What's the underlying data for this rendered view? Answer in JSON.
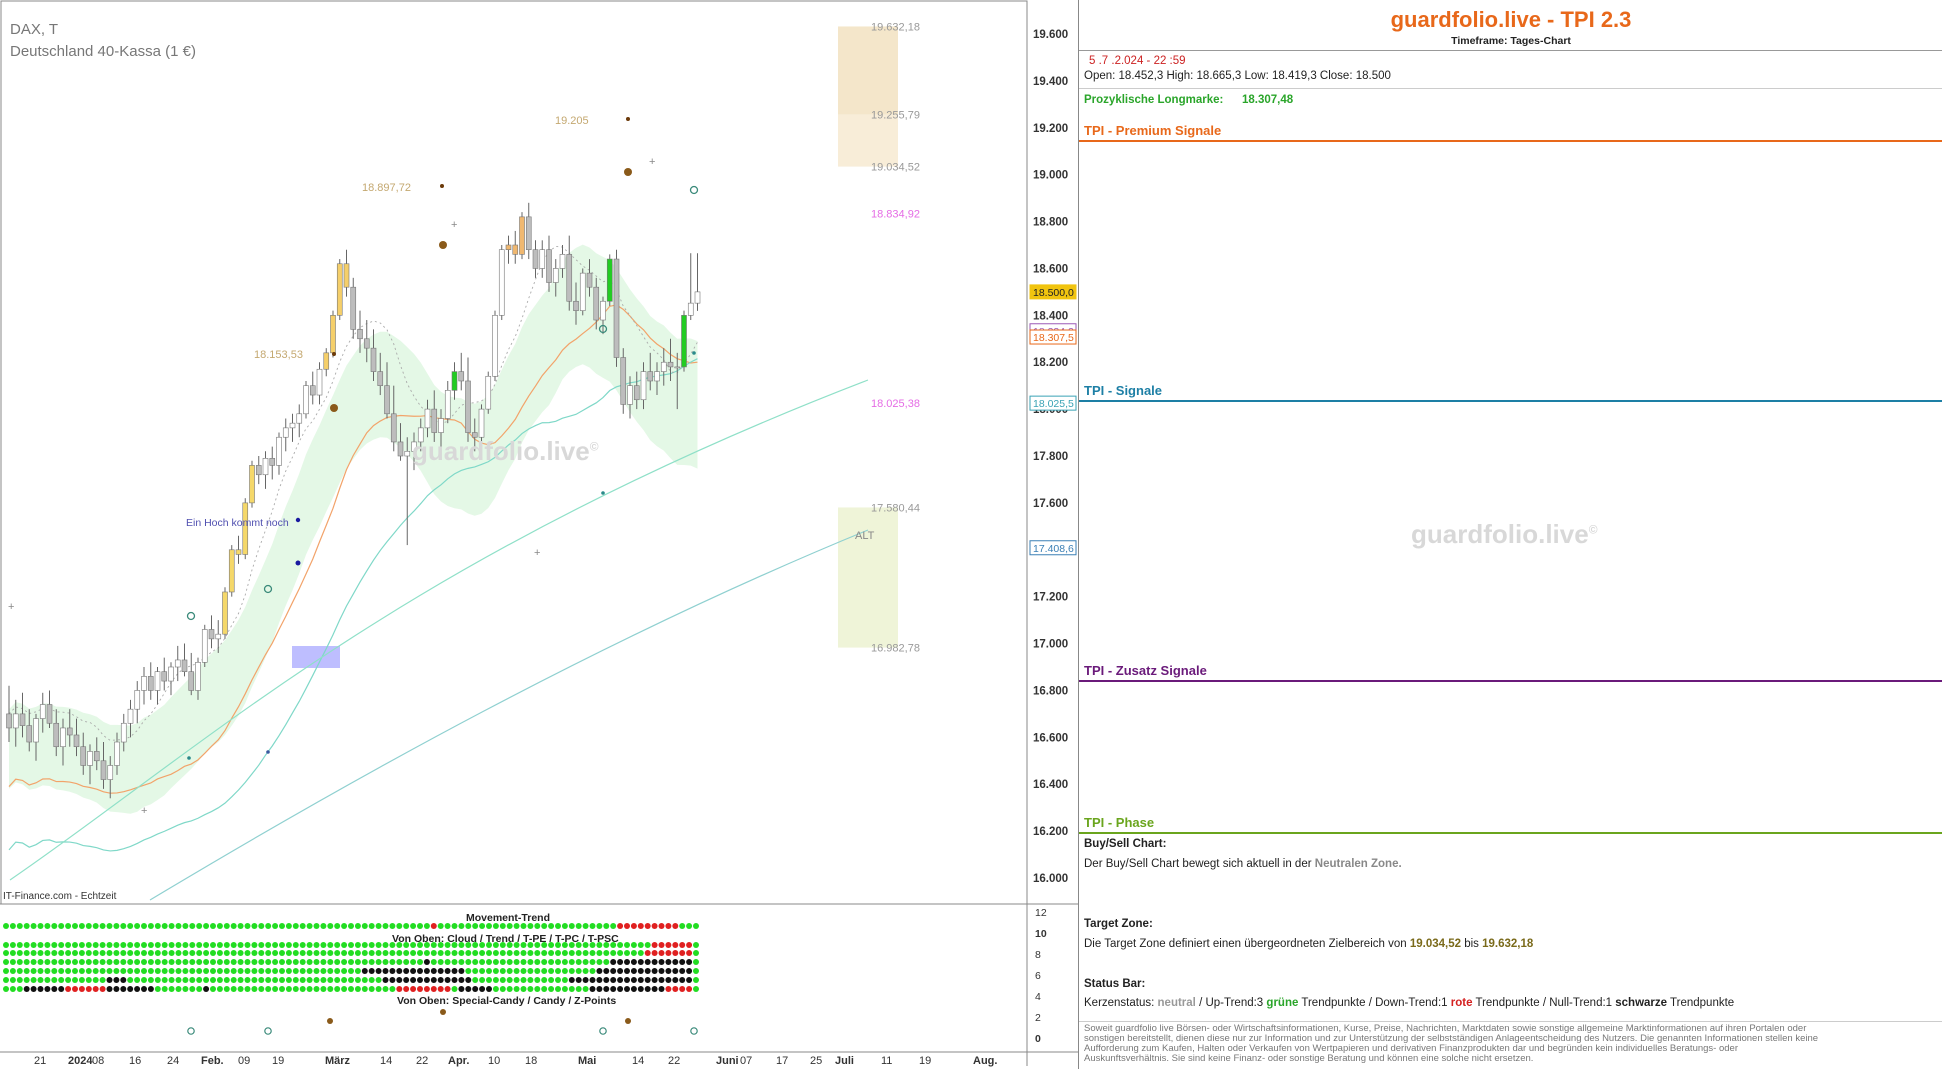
{
  "chart_data": {
    "type": "candlestick",
    "symbol": "DAX, T",
    "subtitle": "Deutschland 40-Kassa (1 €)",
    "source_label": "IT-Finance.com - Echtzeit",
    "watermark": "guardfolio.live",
    "y_axis": {
      "ylim": [
        15850,
        19720
      ],
      "ticks": [
        "19.600",
        "19.400",
        "19.200",
        "19.000",
        "18.800",
        "18.600",
        "18.400",
        "18.200",
        "18.000",
        "17.800",
        "17.600",
        "17.400",
        "17.200",
        "17.000",
        "16.800",
        "16.600",
        "16.400",
        "16.200",
        "16.000"
      ]
    },
    "x_axis": {
      "ticks": [
        "21",
        "2024",
        "08",
        "16",
        "24",
        "Feb.",
        "09",
        "19",
        "März",
        "14",
        "22",
        "Apr.",
        "10",
        "18",
        "Mai",
        "14",
        "22",
        "Juni",
        "07",
        "17",
        "25",
        "Juli",
        "11",
        "19",
        "Aug."
      ]
    },
    "price_tags": [
      {
        "label": "18.500,0",
        "color": "#f1c40f"
      },
      {
        "label": "18.334,2",
        "color": "#9b59b6"
      },
      {
        "label": "18.307,5",
        "color": "#e8681a"
      },
      {
        "label": "18.025,5",
        "color": "#3aa3b5"
      },
      {
        "label": "17.408,6",
        "color": "#3a7fb5"
      }
    ],
    "level_labels": [
      "19.632,18",
      "19.255,79",
      "19.034,52",
      "18.834,92",
      "18.025,38",
      "17.580,44",
      "16.982,78"
    ],
    "annotations": [
      "19.205",
      "18.897,72",
      "18.153,53",
      "Ein Hoch kommt noch",
      "ALT"
    ],
    "ohlc": [
      [
        16700,
        16820,
        16580,
        16640
      ],
      [
        16640,
        16760,
        16560,
        16700
      ],
      [
        16700,
        16790,
        16600,
        16650
      ],
      [
        16650,
        16720,
        16540,
        16580
      ],
      [
        16580,
        16700,
        16500,
        16680
      ],
      [
        16680,
        16790,
        16620,
        16740
      ],
      [
        16740,
        16800,
        16640,
        16660
      ],
      [
        16660,
        16720,
        16520,
        16560
      ],
      [
        16560,
        16680,
        16480,
        16640
      ],
      [
        16640,
        16720,
        16560,
        16610
      ],
      [
        16610,
        16680,
        16520,
        16560
      ],
      [
        16560,
        16620,
        16440,
        16480
      ],
      [
        16480,
        16570,
        16400,
        16540
      ],
      [
        16540,
        16600,
        16460,
        16500
      ],
      [
        16500,
        16580,
        16380,
        16420
      ],
      [
        16420,
        16520,
        16340,
        16480
      ],
      [
        16480,
        16620,
        16440,
        16580
      ],
      [
        16580,
        16700,
        16540,
        16660
      ],
      [
        16660,
        16760,
        16600,
        16720
      ],
      [
        16720,
        16840,
        16660,
        16800
      ],
      [
        16800,
        16900,
        16740,
        16860
      ],
      [
        16860,
        16920,
        16760,
        16800
      ],
      [
        16800,
        16900,
        16740,
        16880
      ],
      [
        16880,
        16940,
        16800,
        16840
      ],
      [
        16840,
        16920,
        16780,
        16900
      ],
      [
        16900,
        16990,
        16840,
        16930
      ],
      [
        16930,
        17000,
        16860,
        16880
      ],
      [
        16880,
        16960,
        16780,
        16800
      ],
      [
        16800,
        16940,
        16760,
        16920
      ],
      [
        16920,
        17080,
        16900,
        17060
      ],
      [
        17060,
        17120,
        16980,
        17020
      ],
      [
        17020,
        17100,
        16960,
        17040
      ],
      [
        17040,
        17240,
        17020,
        17220
      ],
      [
        17220,
        17420,
        17200,
        17400
      ],
      [
        17400,
        17460,
        17340,
        17380
      ],
      [
        17380,
        17620,
        17360,
        17600
      ],
      [
        17600,
        17780,
        17580,
        17760
      ],
      [
        17760,
        17800,
        17680,
        17720
      ],
      [
        17720,
        17820,
        17660,
        17790
      ],
      [
        17790,
        17840,
        17700,
        17760
      ],
      [
        17760,
        17900,
        17720,
        17880
      ],
      [
        17880,
        17960,
        17820,
        17920
      ],
      [
        17920,
        17980,
        17860,
        17940
      ],
      [
        17940,
        18020,
        17880,
        17980
      ],
      [
        17980,
        18120,
        17960,
        18100
      ],
      [
        18100,
        18160,
        18020,
        18060
      ],
      [
        18060,
        18200,
        18020,
        18170
      ],
      [
        18170,
        18260,
        18140,
        18240
      ],
      [
        18240,
        18420,
        18220,
        18400
      ],
      [
        18400,
        18640,
        18380,
        18620
      ],
      [
        18620,
        18680,
        18480,
        18520
      ],
      [
        18520,
        18560,
        18300,
        18340
      ],
      [
        18340,
        18420,
        18240,
        18300
      ],
      [
        18300,
        18380,
        18200,
        18260
      ],
      [
        18260,
        18340,
        18120,
        18160
      ],
      [
        18160,
        18240,
        18060,
        18100
      ],
      [
        18100,
        18200,
        17960,
        17980
      ],
      [
        17980,
        18100,
        17820,
        17860
      ],
      [
        17860,
        17940,
        17780,
        17800
      ],
      [
        17800,
        17880,
        17420,
        17820
      ],
      [
        17820,
        17900,
        17740,
        17860
      ],
      [
        17860,
        17960,
        17820,
        17920
      ],
      [
        17920,
        18040,
        17880,
        18000
      ],
      [
        18000,
        18080,
        17860,
        17900
      ],
      [
        17900,
        18000,
        17820,
        17960
      ],
      [
        17960,
        18120,
        17940,
        18080
      ],
      [
        18080,
        18200,
        18040,
        18160
      ],
      [
        18160,
        18240,
        18080,
        18120
      ],
      [
        18120,
        18220,
        17860,
        17900
      ],
      [
        17900,
        17960,
        17820,
        17880
      ],
      [
        17880,
        18020,
        17860,
        18000
      ],
      [
        18000,
        18160,
        17980,
        18140
      ],
      [
        18140,
        18420,
        18120,
        18400
      ],
      [
        18400,
        18700,
        18380,
        18680
      ],
      [
        18680,
        18740,
        18620,
        18700
      ],
      [
        18700,
        18760,
        18620,
        18660
      ],
      [
        18660,
        18840,
        18640,
        18820
      ],
      [
        18820,
        18880,
        18640,
        18680
      ],
      [
        18680,
        18720,
        18560,
        18600
      ],
      [
        18600,
        18720,
        18560,
        18680
      ],
      [
        18680,
        18740,
        18500,
        18540
      ],
      [
        18540,
        18640,
        18480,
        18600
      ],
      [
        18600,
        18700,
        18560,
        18660
      ],
      [
        18660,
        18740,
        18420,
        18460
      ],
      [
        18460,
        18540,
        18360,
        18420
      ],
      [
        18420,
        18600,
        18400,
        18580
      ],
      [
        18580,
        18640,
        18480,
        18520
      ],
      [
        18520,
        18560,
        18340,
        18380
      ],
      [
        18380,
        18480,
        18320,
        18460
      ],
      [
        18460,
        18660,
        18440,
        18640
      ],
      [
        18640,
        18680,
        18180,
        18220
      ],
      [
        18220,
        18260,
        17980,
        18020
      ],
      [
        18020,
        18140,
        17960,
        18100
      ],
      [
        18100,
        18160,
        18000,
        18040
      ],
      [
        18040,
        18200,
        18000,
        18160
      ],
      [
        18160,
        18240,
        18080,
        18120
      ],
      [
        18120,
        18200,
        18060,
        18160
      ],
      [
        18160,
        18260,
        18100,
        18200
      ],
      [
        18200,
        18300,
        18120,
        18180
      ],
      [
        18180,
        18240,
        18000,
        18180
      ],
      [
        18180,
        18420,
        18160,
        18400
      ],
      [
        18400,
        18665,
        18380,
        18452
      ],
      [
        18452,
        18665,
        18419,
        18500
      ]
    ]
  },
  "indicator_panel": {
    "movement_trend_label": "Movement-Trend",
    "stack_label": "Von Oben: Cloud / Trend / T-PE / T-PC / T-PSC",
    "special_label": "Von Oben: Special-Candy / Candy / Z-Points",
    "axis_ticks": [
      "12",
      "10",
      "8",
      "6",
      "4",
      "2",
      "0"
    ]
  },
  "right": {
    "title": "guardfolio.live - TPI 2.3",
    "timeframe": "Timeframe: Tages-Chart",
    "datetime": "5 .7 .2.024  - 22 :59",
    "ohlc_line": "Open: 18.452,3     High:  18.665,3      Low:  18.419,3     Close:  18.500",
    "longmarke_label": "Prozyklische Longmarke:",
    "longmarke_value": "18.307,48",
    "premium": "TPI - Premium Signale",
    "signale": "TPI - Signale",
    "zusatz": "TPI - Zusatz Signale",
    "phase": "TPI - Phase",
    "watermark": "guardfolio.live",
    "buysell_head": "Buy/Sell Chart:",
    "buysell_text": "Der Buy/Sell Chart bewegt sich aktuell in der",
    "buysell_zone": "Neutralen Zone.",
    "target_head": "Target Zone:",
    "target_text": "Die Target Zone definiert einen übergeordneten Zielbereich von",
    "target_from": "19.034,52",
    "target_bis": "bis",
    "target_to": "19.632,18",
    "status_head": "Status Bar:",
    "status_k": "Kerzenstatus:",
    "status_neutral": "neutral",
    "status_up": "/ Up-Trend:3",
    "status_gruene": "grüne",
    "status_tp1": "Trendpunkte  / Down-Trend:1",
    "status_rote": "rote",
    "status_tp2": "Trendpunkte / Null-Trend:1",
    "status_schwarze": "schwarze",
    "status_tp3": "Trendpunkte",
    "disclaimer": "Soweit guardfolio live Börsen- oder Wirtschaftsinformationen, Kurse, Preise, Nachrichten, Marktdaten sowie sonstige allgemeine Marktinformationen auf ihren Portalen oder sonstigen bereitstellt, dienen diese nur zur Information und zur Unterstützung der selbstständigen Anlageentscheidung des Nutzers. Die genannten Informationen stellen keine Aufforderung zum Kaufen, Halten oder Verkaufen von Wertpapieren und derivativen Finanzprodukten dar und begründen kein individuelles Beratungs- oder Auskunftsverhältnis. Sie sind keine Finanz- oder sonstige Beratung und können eine solche nicht ersetzen."
  }
}
